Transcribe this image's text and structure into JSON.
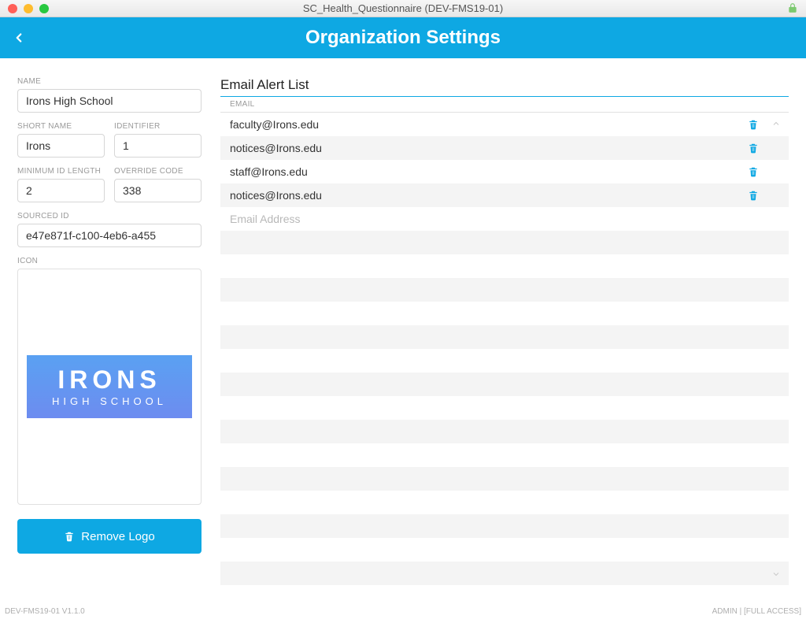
{
  "window": {
    "title": "SC_Health_Questionnaire (DEV-FMS19-01)"
  },
  "header": {
    "title": "Organization Settings"
  },
  "form": {
    "name_label": "NAME",
    "name_value": "Irons High School",
    "short_name_label": "SHORT NAME",
    "short_name_value": "Irons",
    "identifier_label": "IDENTIFIER",
    "identifier_value": "1",
    "min_id_label": "MINIMUM ID LENGTH",
    "min_id_value": "2",
    "override_label": "OVERRIDE CODE",
    "override_value": "338",
    "sourced_id_label": "SOURCED ID",
    "sourced_id_value": "e47e871f-c100-4eb6-a455",
    "icon_label": "ICON",
    "logo_line1": "IRONS",
    "logo_line2": "HIGH SCHOOL",
    "remove_logo_label": "Remove Logo"
  },
  "email_section": {
    "title": "Email Alert List",
    "column_label": "EMAIL",
    "placeholder": "Email Address",
    "rows": [
      "faculty@Irons.edu",
      "notices@Irons.edu",
      "staff@Irons.edu",
      "notices@Irons.edu"
    ]
  },
  "footer": {
    "left": "DEV-FMS19-01 V1.1.0",
    "right": "ADMIN | [FULL ACCESS]"
  }
}
